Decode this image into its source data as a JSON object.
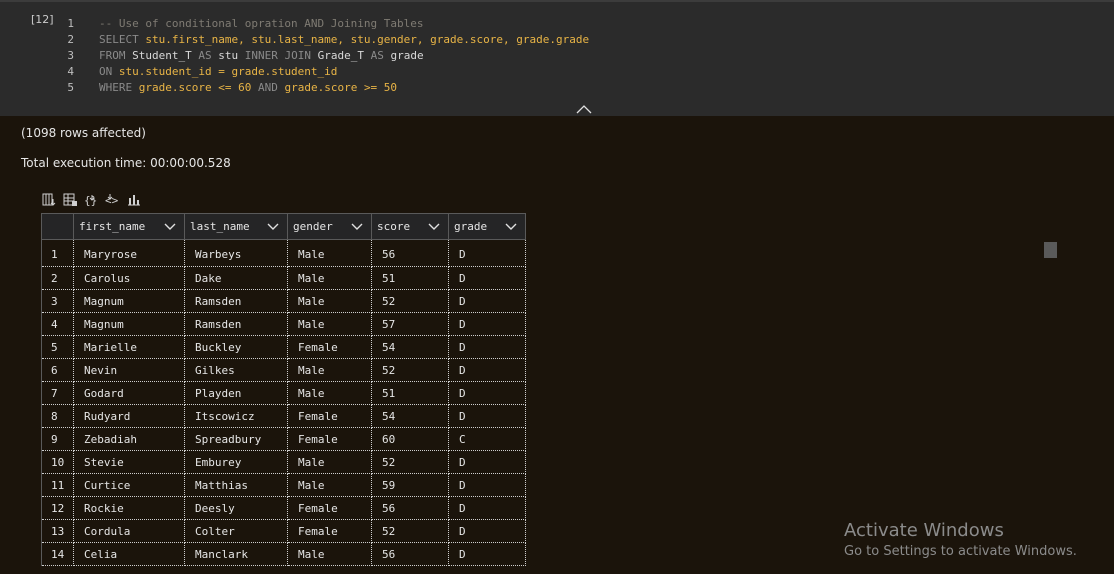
{
  "cell": {
    "exec_count": "[12]",
    "lines": [
      {
        "n": "1",
        "tokens": [
          {
            "t": "comment",
            "v": "-- Use of conditional opration AND Joining Tables"
          }
        ]
      },
      {
        "n": "2",
        "tokens": [
          {
            "t": "kw",
            "v": "SELECT "
          },
          {
            "t": "id",
            "v": "stu.first_name, stu.last_name, stu.gender, grade.score, grade.grade"
          }
        ]
      },
      {
        "n": "3",
        "tokens": [
          {
            "t": "kw",
            "v": "FROM "
          },
          {
            "t": "plain",
            "v": "Student_T "
          },
          {
            "t": "kw",
            "v": "AS "
          },
          {
            "t": "plain",
            "v": "stu "
          },
          {
            "t": "kw",
            "v": "INNER JOIN "
          },
          {
            "t": "plain",
            "v": "Grade_T "
          },
          {
            "t": "kw",
            "v": "AS "
          },
          {
            "t": "plain",
            "v": "grade"
          }
        ]
      },
      {
        "n": "4",
        "tokens": [
          {
            "t": "kw",
            "v": "ON "
          },
          {
            "t": "id",
            "v": "stu.student_id = grade.student_id"
          }
        ]
      },
      {
        "n": "5",
        "tokens": [
          {
            "t": "kw",
            "v": "WHERE "
          },
          {
            "t": "id",
            "v": "grade.score <= 60 "
          },
          {
            "t": "kw",
            "v": "AND "
          },
          {
            "t": "id",
            "v": "grade.score >= 50"
          }
        ]
      }
    ]
  },
  "output": {
    "rows_affected": "(1098 rows affected)",
    "exec_time": "Total execution time: 00:00:00.528"
  },
  "toolbar_icons": [
    "save-as-csv-icon",
    "save-as-excel-icon",
    "save-as-json-icon",
    "save-as-xml-icon",
    "chart-icon"
  ],
  "grid": {
    "columns": [
      {
        "label": "first_name",
        "width": 111
      },
      {
        "label": "last_name",
        "width": 103
      },
      {
        "label": "gender",
        "width": 84
      },
      {
        "label": "score",
        "width": 77
      },
      {
        "label": "grade",
        "width": 77
      }
    ],
    "rows": [
      [
        "1",
        "Maryrose",
        "Warbeys",
        "Male",
        "56",
        "D"
      ],
      [
        "2",
        "Carolus",
        "Dake",
        "Male",
        "51",
        "D"
      ],
      [
        "3",
        "Magnum",
        "Ramsden",
        "Male",
        "52",
        "D"
      ],
      [
        "4",
        "Magnum",
        "Ramsden",
        "Male",
        "57",
        "D"
      ],
      [
        "5",
        "Marielle",
        "Buckley",
        "Female",
        "54",
        "D"
      ],
      [
        "6",
        "Nevin",
        "Gilkes",
        "Male",
        "52",
        "D"
      ],
      [
        "7",
        "Godard",
        "Playden",
        "Male",
        "51",
        "D"
      ],
      [
        "8",
        "Rudyard",
        "Itscowicz",
        "Female",
        "54",
        "D"
      ],
      [
        "9",
        "Zebadiah",
        "Spreadbury",
        "Female",
        "60",
        "C"
      ],
      [
        "10",
        "Stevie",
        "Emburey",
        "Male",
        "52",
        "D"
      ],
      [
        "11",
        "Curtice",
        "Matthias",
        "Male",
        "59",
        "D"
      ],
      [
        "12",
        "Rockie",
        "Deesly",
        "Female",
        "56",
        "D"
      ],
      [
        "13",
        "Cordula",
        "Colter",
        "Female",
        "52",
        "D"
      ],
      [
        "14",
        "Celia",
        "Manclark",
        "Male",
        "56",
        "D"
      ]
    ]
  },
  "watermark": {
    "title": "Activate Windows",
    "subtitle": "Go to Settings to activate Windows."
  }
}
